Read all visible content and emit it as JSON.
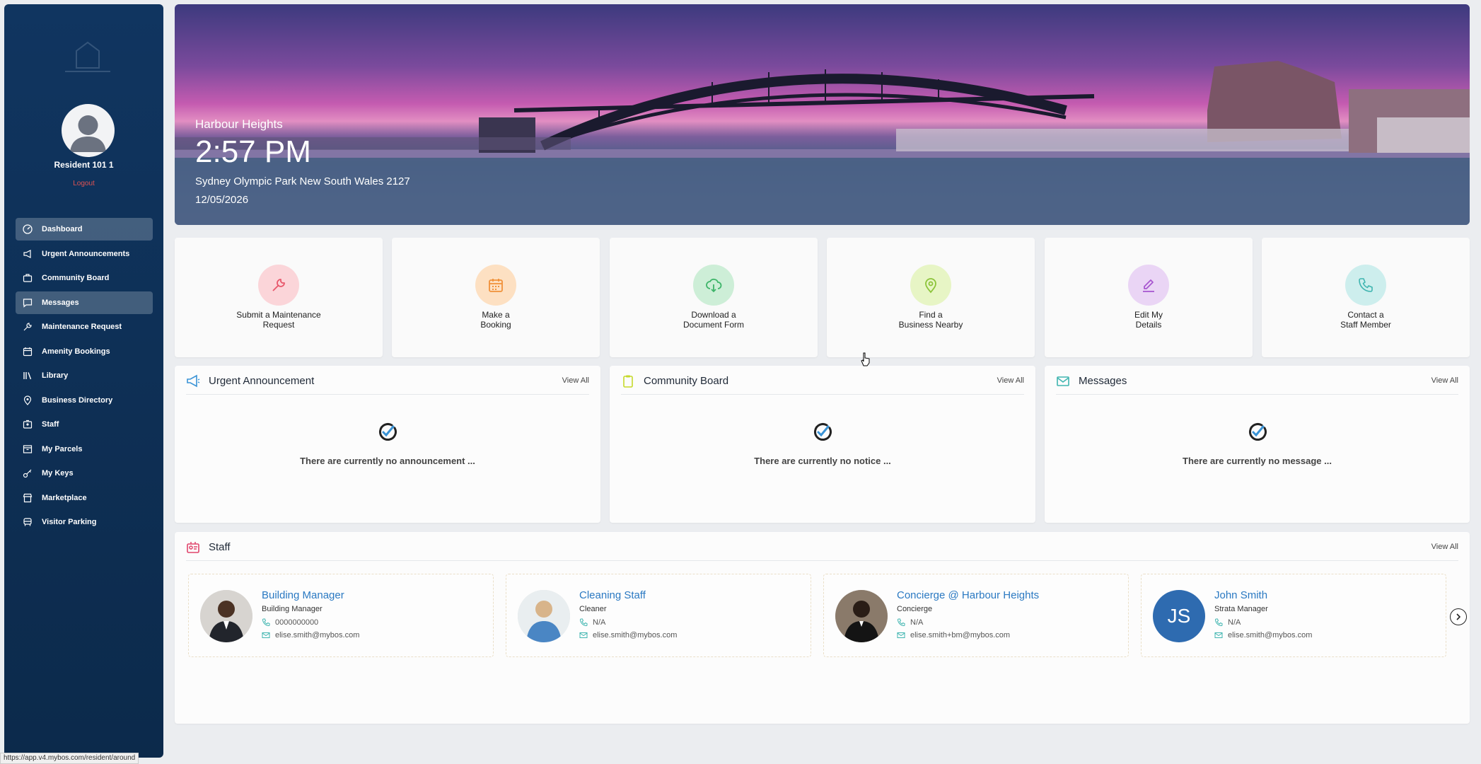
{
  "sidebar": {
    "resident_name": "Resident 101 1",
    "logout_label": "Logout",
    "items": [
      {
        "label": "Dashboard",
        "icon": "dashboard-icon",
        "active": true
      },
      {
        "label": "Urgent Announcements",
        "icon": "megaphone-icon",
        "active": false
      },
      {
        "label": "Community Board",
        "icon": "briefcase-icon",
        "active": false
      },
      {
        "label": "Messages",
        "icon": "chat-icon",
        "active": true
      },
      {
        "label": "Maintenance Request",
        "icon": "wrench-icon",
        "active": false
      },
      {
        "label": "Amenity Bookings",
        "icon": "calendar-icon",
        "active": false
      },
      {
        "label": "Library",
        "icon": "library-icon",
        "active": false
      },
      {
        "label": "Business Directory",
        "icon": "location-pin-icon",
        "active": false
      },
      {
        "label": "Staff",
        "icon": "id-badge-icon",
        "active": false
      },
      {
        "label": "My Parcels",
        "icon": "parcel-icon",
        "active": false
      },
      {
        "label": "My Keys",
        "icon": "key-icon",
        "active": false
      },
      {
        "label": "Marketplace",
        "icon": "store-icon",
        "active": false
      },
      {
        "label": "Visitor Parking",
        "icon": "car-icon",
        "active": false
      }
    ]
  },
  "hero": {
    "building_name": "Harbour Heights",
    "time": "2:57 PM",
    "address": "Sydney Olympic Park New South Wales 2127",
    "date": "12/05/2026"
  },
  "quick_actions": [
    {
      "line1": "Submit a Maintenance",
      "line2": "Request",
      "icon": "wrench-icon",
      "bg": "#fbd5d9",
      "fg": "#e8576b"
    },
    {
      "line1": "Make a",
      "line2": "Booking",
      "icon": "calendar-icon",
      "bg": "#fde0c2",
      "fg": "#f0913a"
    },
    {
      "line1": "Download a",
      "line2": "Document Form",
      "icon": "cloud-download-icon",
      "bg": "#cdeed7",
      "fg": "#3fb56a"
    },
    {
      "line1": "Find a",
      "line2": "Business Nearby",
      "icon": "location-pin-icon",
      "bg": "#e7f5c5",
      "fg": "#8cc43a"
    },
    {
      "line1": "Edit My",
      "line2": "Details",
      "icon": "edit-icon",
      "bg": "#ead5f5",
      "fg": "#a857d0"
    },
    {
      "line1": "Contact a",
      "line2": "Staff Member",
      "icon": "phone-icon",
      "bg": "#cdeeed",
      "fg": "#3fb5b0"
    }
  ],
  "panels": {
    "announcement": {
      "title": "Urgent Announcement",
      "view_all": "View All",
      "empty": "There are currently no announcement ..."
    },
    "community": {
      "title": "Community Board",
      "view_all": "View All",
      "empty": "There are currently no notice ..."
    },
    "messages": {
      "title": "Messages",
      "view_all": "View All",
      "empty": "There are currently no message ..."
    },
    "staff": {
      "title": "Staff",
      "view_all": "View All"
    }
  },
  "staff": [
    {
      "name": "Building Manager",
      "role": "Building Manager",
      "phone": "0000000000",
      "email": "elise.smith@mybos.com"
    },
    {
      "name": "Cleaning Staff",
      "role": "Cleaner",
      "phone": "N/A",
      "email": "elise.smith@mybos.com"
    },
    {
      "name": "Concierge @ Harbour Heights",
      "role": "Concierge",
      "phone": "N/A",
      "email": "elise.smith+bm@mybos.com"
    },
    {
      "name": "John Smith",
      "role": "Strata Manager",
      "phone": "N/A",
      "email": "elise.smith@mybos.com",
      "initials": "JS"
    }
  ],
  "status_url": "https://app.v4.mybos.com/resident/around"
}
